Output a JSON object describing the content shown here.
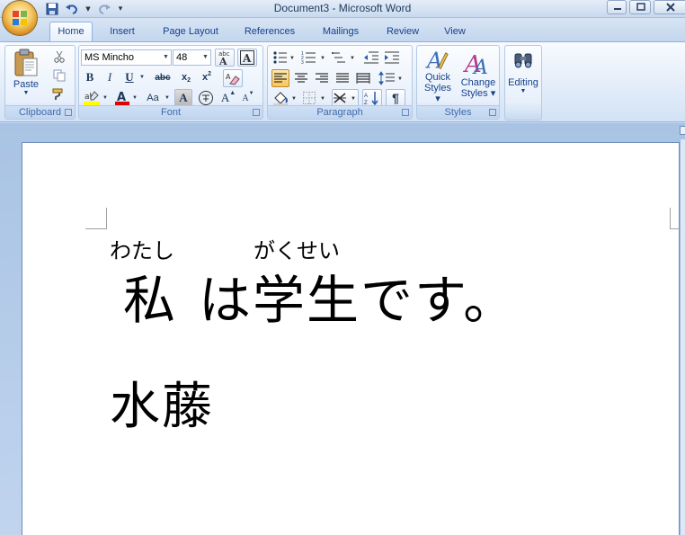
{
  "window": {
    "title": "Document3 - Microsoft Word"
  },
  "tabs": [
    "Home",
    "Insert",
    "Page Layout",
    "References",
    "Mailings",
    "Review",
    "View"
  ],
  "active_tab": "Home",
  "ribbon": {
    "clipboard": {
      "label": "Clipboard",
      "paste_label": "Paste"
    },
    "font": {
      "label": "Font",
      "font_name": "MS Mincho",
      "font_size": "48"
    },
    "paragraph": {
      "label": "Paragraph"
    },
    "styles": {
      "label": "Styles",
      "quick_styles_line1": "Quick",
      "quick_styles_line2": "Styles",
      "change_styles_line1": "Change",
      "change_styles_line2": "Styles"
    },
    "editing": {
      "label": "Editing"
    }
  },
  "document": {
    "furigana": [
      {
        "text": "わたし"
      },
      {
        "text": "がくせい"
      }
    ],
    "line1": [
      {
        "text": "私"
      },
      {
        "text": "は学生です。"
      }
    ],
    "line2": "水藤"
  },
  "colors": {
    "accent": "#15428b",
    "highlight_yellow": "#ffff00",
    "font_color_red": "#e00000"
  }
}
